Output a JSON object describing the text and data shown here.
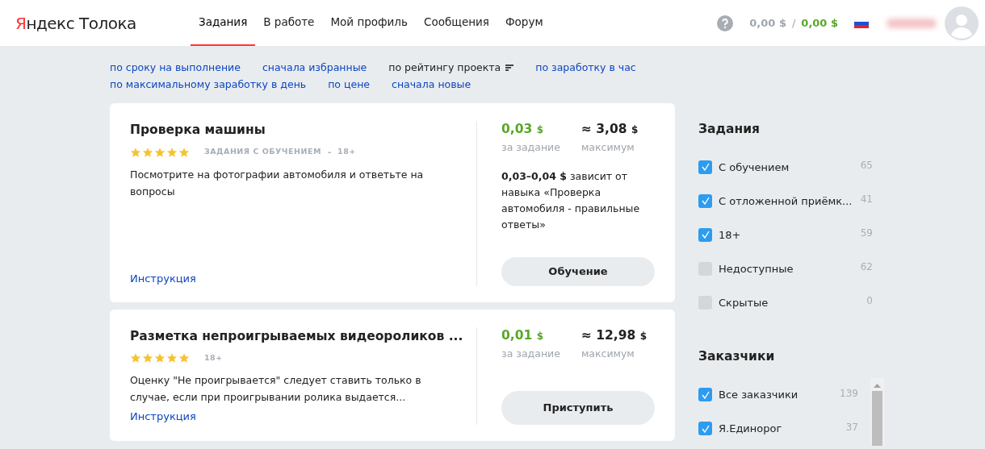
{
  "header": {
    "logo": {
      "brand": "Яндекс",
      "product": "Толока"
    },
    "tabs": [
      {
        "label": "Задания",
        "selected": true
      },
      {
        "label": "В работе",
        "selected": false
      },
      {
        "label": "Мой профиль",
        "selected": false
      },
      {
        "label": "Сообщения",
        "selected": false
      },
      {
        "label": "Форум",
        "selected": false
      }
    ],
    "balance": "0,00 $",
    "separator": "/",
    "earned": "0,00 $"
  },
  "sorting": [
    [
      {
        "label": "по сроку на выполнение",
        "selected": false
      },
      {
        "label": "сначала избранные",
        "selected": false
      },
      {
        "label": "по рейтингу проекта",
        "selected": true
      },
      {
        "label": "по заработку в час",
        "selected": false
      }
    ],
    [
      {
        "label": "по максимальному заработку в день",
        "selected": false
      },
      {
        "label": "по цене",
        "selected": false
      },
      {
        "label": "сначала новые",
        "selected": false
      }
    ]
  ],
  "tasks": [
    {
      "title": "Проверка машины",
      "stars": 5,
      "tags": [
        "ЗАДАНИЯ С ОБУЧЕНИЕМ",
        "18+"
      ],
      "tag_separator": "-",
      "description": "Посмотрите на фотографии автомобиля и ответьте на вопросы",
      "link": "Инструкция",
      "price": "0,03",
      "price_currency": "$",
      "price_label": "за задание",
      "max_prefix": "≈",
      "max": "3,08",
      "max_currency": "$",
      "max_label": "максимум",
      "note": "**0,03–0,04 $** зависит от навыка «Проверка автомобиля - правильные ответы»",
      "button": "Обучение"
    },
    {
      "title": "Разметка непроигрываемых видеороликов ...",
      "stars": 5,
      "tags": [
        "18+"
      ],
      "description": "Оценку \"Не проигрывается\" следует ставить только в случае, если при проигрывании ролика выдается...",
      "link": "Инструкция",
      "price": "0,01",
      "price_currency": "$",
      "price_label": "за задание",
      "max_prefix": "≈",
      "max": "12,98",
      "max_currency": "$",
      "max_label": "максимум",
      "button": "Приступить"
    }
  ],
  "filters": [
    {
      "title": "Задания",
      "scroll": false,
      "items": [
        {
          "label": "С обучением",
          "checked": true,
          "count": "65"
        },
        {
          "label": "С отложенной приёмк...",
          "checked": true,
          "count": "41"
        },
        {
          "label": "18+",
          "checked": true,
          "count": "59"
        },
        {
          "label": "Недоступные",
          "checked": false,
          "count": "62"
        },
        {
          "label": "Скрытые",
          "checked": false,
          "count": "0"
        }
      ]
    },
    {
      "title": "Заказчики",
      "scroll": true,
      "items": [
        {
          "label": "Все заказчики",
          "checked": true,
          "count": "139"
        },
        {
          "label": "Я.Единорог",
          "checked": true,
          "count": "37"
        }
      ]
    }
  ]
}
